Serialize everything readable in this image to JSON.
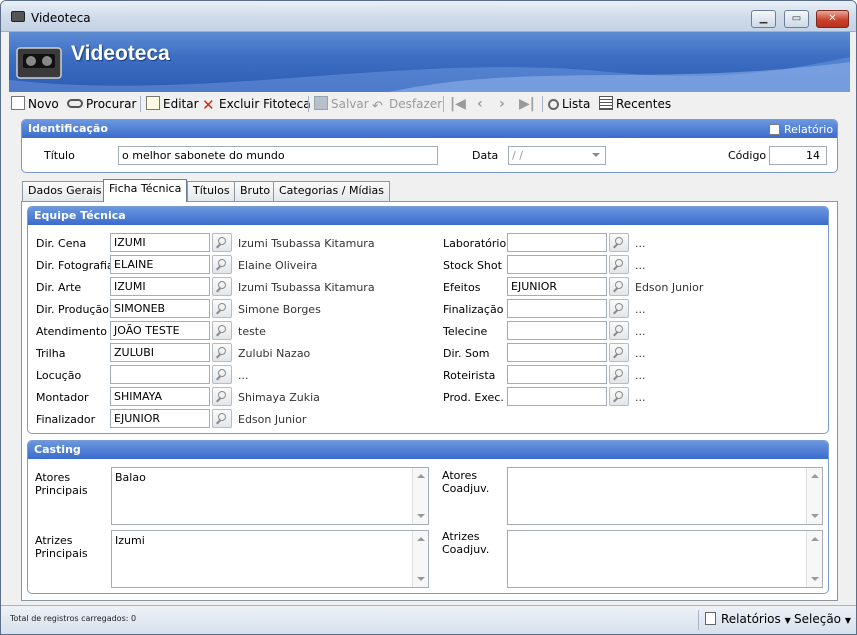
{
  "window": {
    "title": "Videoteca"
  },
  "banner": {
    "title": "Videoteca"
  },
  "toolbar": {
    "novo": "Novo",
    "procurar": "Procurar",
    "editar": "Editar",
    "excluir": "Excluir Fitoteca",
    "salvar": "Salvar",
    "desfazer": "Desfazer",
    "lista": "Lista",
    "recentes": "Recentes"
  },
  "identificacao": {
    "header": "Identificação",
    "relatorio_label": "Relatório",
    "titulo_label": "Título",
    "titulo_value": "o melhor sabonete do mundo",
    "data_label": "Data",
    "data_value": " / /",
    "codigo_label": "Código",
    "codigo_value": "14"
  },
  "tabs": [
    "Dados Gerais",
    "Ficha Técnica",
    "Títulos",
    "Bruto",
    "Categorias / Mídias"
  ],
  "equipe": {
    "header": "Equipe Técnica",
    "left": [
      {
        "label": "Dir. Cena",
        "code": "IZUMI",
        "name": "Izumi Tsubassa Kitamura"
      },
      {
        "label": "Dir. Fotografia",
        "code": "ELAINE",
        "name": "Elaine Oliveira"
      },
      {
        "label": "Dir. Arte",
        "code": "IZUMI",
        "name": "Izumi Tsubassa Kitamura"
      },
      {
        "label": "Dir. Produção",
        "code": "SIMONEB",
        "name": "Simone Borges"
      },
      {
        "label": "Atendimento",
        "code": "JOÃO TESTE",
        "name": "teste"
      },
      {
        "label": "Trilha",
        "code": "ZULUBI",
        "name": "Zulubi Nazao"
      },
      {
        "label": "Locução",
        "code": "",
        "name": "..."
      },
      {
        "label": "Montador",
        "code": "SHIMAYA",
        "name": "Shimaya Zukia"
      },
      {
        "label": "Finalizador",
        "code": "EJUNIOR",
        "name": "Edson Junior"
      }
    ],
    "right": [
      {
        "label": "Laboratório",
        "code": "",
        "name": "..."
      },
      {
        "label": "Stock Shot",
        "code": "",
        "name": "..."
      },
      {
        "label": "Efeitos",
        "code": "EJUNIOR",
        "name": "Edson Junior"
      },
      {
        "label": "Finalização",
        "code": "",
        "name": "..."
      },
      {
        "label": "Telecine",
        "code": "",
        "name": "..."
      },
      {
        "label": "Dir. Som",
        "code": "",
        "name": "..."
      },
      {
        "label": "Roteirista",
        "code": "",
        "name": "..."
      },
      {
        "label": "Prod. Exec.",
        "code": "",
        "name": "..."
      }
    ]
  },
  "casting": {
    "header": "Casting",
    "atores_principais_label": "Atores Principais",
    "atores_principais_value": "Balao",
    "atores_coadj_label": "Atores Coadjuv.",
    "atores_coadj_value": "",
    "atrizes_principais_label": "Atrizes Principais",
    "atrizes_principais_value": "Izumi",
    "atrizes_coadj_label": "Atrizes Coadjuv.",
    "atrizes_coadj_value": ""
  },
  "status": {
    "text": "Total de registros carregados: 0",
    "relatorios": "Relatórios",
    "selecao": "Seleção"
  }
}
